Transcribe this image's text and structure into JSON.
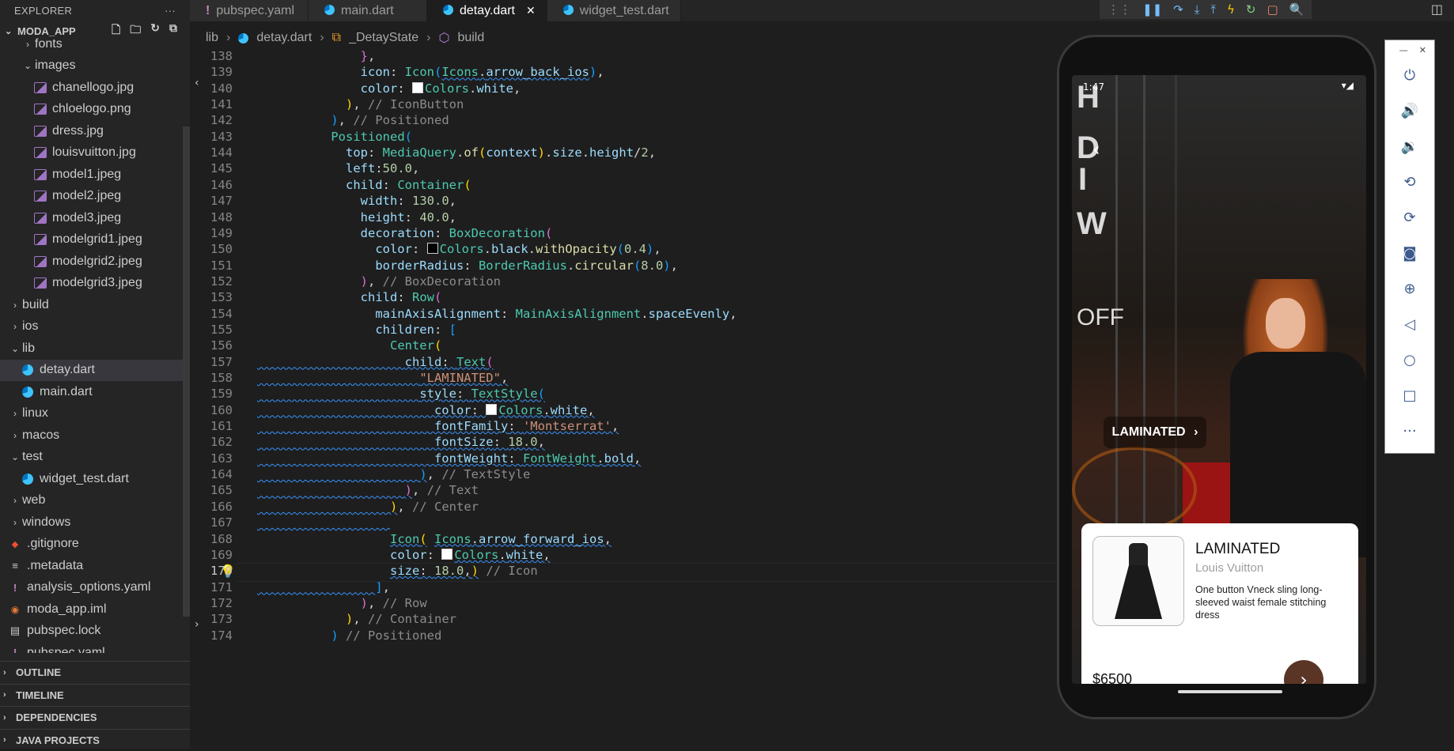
{
  "explorer": {
    "title": "EXPLORER",
    "more": "···",
    "project": "MODA_APP",
    "items": [
      {
        "label": "fonts",
        "type": "folder",
        "indent": 1,
        "open": false
      },
      {
        "label": "images",
        "type": "folder",
        "indent": 1,
        "open": true
      },
      {
        "label": "chanellogo.jpg",
        "type": "image",
        "indent": 2
      },
      {
        "label": "chloelogo.png",
        "type": "image",
        "indent": 2
      },
      {
        "label": "dress.jpg",
        "type": "image",
        "indent": 2
      },
      {
        "label": "louisvuitton.jpg",
        "type": "image",
        "indent": 2
      },
      {
        "label": "model1.jpeg",
        "type": "image",
        "indent": 2
      },
      {
        "label": "model2.jpeg",
        "type": "image",
        "indent": 2
      },
      {
        "label": "model3.jpeg",
        "type": "image",
        "indent": 2
      },
      {
        "label": "modelgrid1.jpeg",
        "type": "image",
        "indent": 2
      },
      {
        "label": "modelgrid2.jpeg",
        "type": "image",
        "indent": 2
      },
      {
        "label": "modelgrid3.jpeg",
        "type": "image",
        "indent": 2
      },
      {
        "label": "build",
        "type": "folder",
        "indent": 0,
        "open": false
      },
      {
        "label": "ios",
        "type": "folder",
        "indent": 0,
        "open": false
      },
      {
        "label": "lib",
        "type": "folder",
        "indent": 0,
        "open": true
      },
      {
        "label": "detay.dart",
        "type": "dart",
        "indent": 1,
        "selected": true
      },
      {
        "label": "main.dart",
        "type": "dart",
        "indent": 1
      },
      {
        "label": "linux",
        "type": "folder",
        "indent": 0,
        "open": false
      },
      {
        "label": "macos",
        "type": "folder",
        "indent": 0,
        "open": false
      },
      {
        "label": "test",
        "type": "folder",
        "indent": 0,
        "open": true
      },
      {
        "label": "widget_test.dart",
        "type": "dart",
        "indent": 1
      },
      {
        "label": "web",
        "type": "folder",
        "indent": 0,
        "open": false
      },
      {
        "label": "windows",
        "type": "folder",
        "indent": 0,
        "open": false
      },
      {
        "label": ".gitignore",
        "type": "git",
        "indent": 0
      },
      {
        "label": ".metadata",
        "type": "meta",
        "indent": 0
      },
      {
        "label": "analysis_options.yaml",
        "type": "yaml",
        "indent": 0
      },
      {
        "label": "moda_app.iml",
        "type": "rss",
        "indent": 0
      },
      {
        "label": "pubspec.lock",
        "type": "lock",
        "indent": 0
      },
      {
        "label": "pubspec.yaml",
        "type": "yaml",
        "indent": 0
      }
    ],
    "sections": [
      "OUTLINE",
      "TIMELINE",
      "DEPENDENCIES",
      "JAVA PROJECTS"
    ]
  },
  "tabs": [
    {
      "label": "pubspec.yaml",
      "icon": "yaml",
      "active": false
    },
    {
      "label": "main.dart",
      "icon": "dart",
      "active": false
    },
    {
      "label": "detay.dart",
      "icon": "dart",
      "active": true
    },
    {
      "label": "widget_test.dart",
      "icon": "dart",
      "active": false
    }
  ],
  "breadcrumb": [
    "lib",
    "detay.dart",
    "_DetayState",
    "build"
  ],
  "editor": {
    "current_line": 170,
    "lines": [
      {
        "n": 138,
        "html": "              <span class=\"b2\">}</span>,"
      },
      {
        "n": 139,
        "html": "              <span class=\"k\">icon</span>: <span class=\"t\">Icon</span><span class=\"b3\">(</span><span class=\"t squig\">Icons</span><span class=\"squig\">.</span><span class=\"k squig\">arrow_back_ios</span><span class=\"b3\">)</span>,"
      },
      {
        "n": 140,
        "html": "              <span class=\"k\">color</span>: <span class=\"swatch\" style=\"background:#fff\"></span><span class=\"t\">Colors</span>.<span class=\"k\">white</span>,"
      },
      {
        "n": 141,
        "html": "            <span class=\"b1\">)</span>, <span class=\"cm\">// IconButton</span>"
      },
      {
        "n": 142,
        "html": "          <span class=\"b3\">)</span>, <span class=\"cm\">// Positioned</span>"
      },
      {
        "n": 143,
        "html": "          <span class=\"t\">Positioned</span><span class=\"b3\">(</span>"
      },
      {
        "n": 144,
        "html": "            <span class=\"k\">top</span>: <span class=\"t\">MediaQuery</span>.<span class=\"f\">of</span><span class=\"b1\">(</span><span class=\"k\">context</span><span class=\"b1\">)</span>.<span class=\"k\">size</span>.<span class=\"k\">height</span>/<span class=\"n\">2</span>,"
      },
      {
        "n": 145,
        "html": "            <span class=\"k\">left</span>:<span class=\"n\">50.0</span>,"
      },
      {
        "n": 146,
        "html": "            <span class=\"k\">child</span>: <span class=\"t\">Container</span><span class=\"b1\">(</span>"
      },
      {
        "n": 147,
        "html": "              <span class=\"k\">width</span>: <span class=\"n\">130.0</span>,"
      },
      {
        "n": 148,
        "html": "              <span class=\"k\">height</span>: <span class=\"n\">40.0</span>,"
      },
      {
        "n": 149,
        "html": "              <span class=\"k\">decoration</span>: <span class=\"t\">BoxDecoration</span><span class=\"b2\">(</span>"
      },
      {
        "n": 150,
        "html": "                <span class=\"k\">color</span>: <span class=\"swatch\" style=\"background:#000\"></span><span class=\"t\">Colors</span>.<span class=\"k\">black</span>.<span class=\"f\">withOpacity</span><span class=\"b3\">(</span><span class=\"n\">0.4</span><span class=\"b3\">)</span>,"
      },
      {
        "n": 151,
        "html": "                <span class=\"k\">borderRadius</span>: <span class=\"t\">BorderRadius</span>.<span class=\"f\">circular</span><span class=\"b3\">(</span><span class=\"n\">8.0</span><span class=\"b3\">)</span>,"
      },
      {
        "n": 152,
        "html": "              <span class=\"b2\">)</span>, <span class=\"cm\">// BoxDecoration</span>"
      },
      {
        "n": 153,
        "html": "              <span class=\"k\">child</span>: <span class=\"t\">Row</span><span class=\"b2\">(</span>"
      },
      {
        "n": 154,
        "html": "                <span class=\"k\">mainAxisAlignment</span>: <span class=\"t\">MainAxisAlignment</span>.<span class=\"k\">spaceEvenly</span>,"
      },
      {
        "n": 155,
        "html": "                <span class=\"k\">children</span>: <span class=\"b3\">[</span>"
      },
      {
        "n": 156,
        "html": "                  <span class=\"t\">Center</span><span class=\"b1\">(</span>"
      },
      {
        "n": 157,
        "html": "<span class=\"squig\">                    </span><span class=\"k squig\">child</span><span class=\"squig\">: </span><span class=\"t squig\">Text</span><span class=\"b2 squig\">(</span>"
      },
      {
        "n": 158,
        "html": "<span class=\"squig\">                      </span><span class=\"s squig\">\"LAMINATED\"</span><span class=\"squig\">,</span>"
      },
      {
        "n": 159,
        "html": "<span class=\"squig\">                      </span><span class=\"k squig\">style</span><span class=\"squig\">: </span><span class=\"t squig\">TextStyle</span><span class=\"b3 squig\">(</span>"
      },
      {
        "n": 160,
        "html": "<span class=\"squig\">                        </span><span class=\"k squig\">color</span><span class=\"squig\">: </span><span class=\"swatch\" style=\"background:#fff\"></span><span class=\"t squig\">Colors</span><span class=\"squig\">.</span><span class=\"k squig\">white</span><span class=\"squig\">,</span>"
      },
      {
        "n": 161,
        "html": "<span class=\"squig\">                        </span><span class=\"k squig\">fontFamily</span><span class=\"squig\">: </span><span class=\"s squig\">'Montserrat'</span><span class=\"squig\">,</span>"
      },
      {
        "n": 162,
        "html": "<span class=\"squig\">                        </span><span class=\"k squig\">fontSize</span><span class=\"squig\">: </span><span class=\"n squig\">18.0</span><span class=\"squig\">,</span>"
      },
      {
        "n": 163,
        "html": "<span class=\"squig\">                        </span><span class=\"k squig\">fontWeight</span><span class=\"squig\">: </span><span class=\"t squig\">FontWeight</span><span class=\"squig\">.</span><span class=\"k squig\">bold</span><span class=\"squig\">,</span>"
      },
      {
        "n": 164,
        "html": "<span class=\"squig\">                      </span><span class=\"b3 squig\">)</span>, <span class=\"cm\">// TextStyle</span>"
      },
      {
        "n": 165,
        "html": "<span class=\"squig\">                    </span><span class=\"b2 squig\">)</span>, <span class=\"cm\">// Text</span>"
      },
      {
        "n": 166,
        "html": "<span class=\"squig\">                  </span><span class=\"b1 squig\">)</span>, <span class=\"cm\">// Center</span>"
      },
      {
        "n": 167,
        "html": "<span class=\"squig\">                  </span>"
      },
      {
        "n": 168,
        "html": "                  <span class=\"t squig\">Icon</span><span class=\"b1 squig\">(</span> <span class=\"t squig\">Icons</span><span class=\"squig\">.</span><span class=\"k squig\">arrow_forward_ios</span><span class=\"squig\">,</span>"
      },
      {
        "n": 169,
        "html": "                  <span class=\"k\">color</span>: <span class=\"swatch\" style=\"background:#fff\"></span><span class=\"t squig\">Colors</span><span class=\"squig\">.</span><span class=\"k squig\">white</span><span class=\"squig\">,</span>"
      },
      {
        "n": 170,
        "html": "                  <span class=\"k squig\">size</span><span class=\"squig\">: </span><span class=\"n squig\">18.0</span><span class=\"squig\">,</span><span class=\"b1 squig\">)</span> <span class=\"cm\">// Icon</span>"
      },
      {
        "n": 171,
        "html": "<span class=\"squig\">                </span><span class=\"b3\">]</span>,"
      },
      {
        "n": 172,
        "html": "              <span class=\"b2\">)</span>, <span class=\"cm\">// Row</span>"
      },
      {
        "n": 173,
        "html": "            <span class=\"b1\">)</span>, <span class=\"cm\">// Container</span>"
      },
      {
        "n": 174,
        "html": "          <span class=\"b3\">)</span> <span class=\"cm\">// Positioned</span>"
      }
    ]
  },
  "device": {
    "status_time": "1:47",
    "big_letters": [
      "H",
      "D",
      "I",
      "W"
    ],
    "offer_text": "OFF",
    "button_label": "LAMINATED",
    "button_arrow": "›",
    "back_icon": "‹",
    "card": {
      "title": "LAMINATED",
      "brand": "Louis Vuitton",
      "description": "One button Vneck sling long-sleeved waist female stitching dress",
      "price": "$6500",
      "go_icon": "›"
    }
  },
  "emulator_controls": [
    "power-icon",
    "volume-up-icon",
    "volume-down-icon",
    "rotate-left-icon",
    "rotate-right-icon",
    "camera-icon",
    "zoom-icon",
    "back-icon",
    "home-icon",
    "overview-icon",
    "more-icon"
  ],
  "colors": {
    "editor_bg": "#1e1e1e",
    "sidebar_bg": "#252526",
    "card_button": "#5a3526",
    "accent": "#3794ff"
  }
}
